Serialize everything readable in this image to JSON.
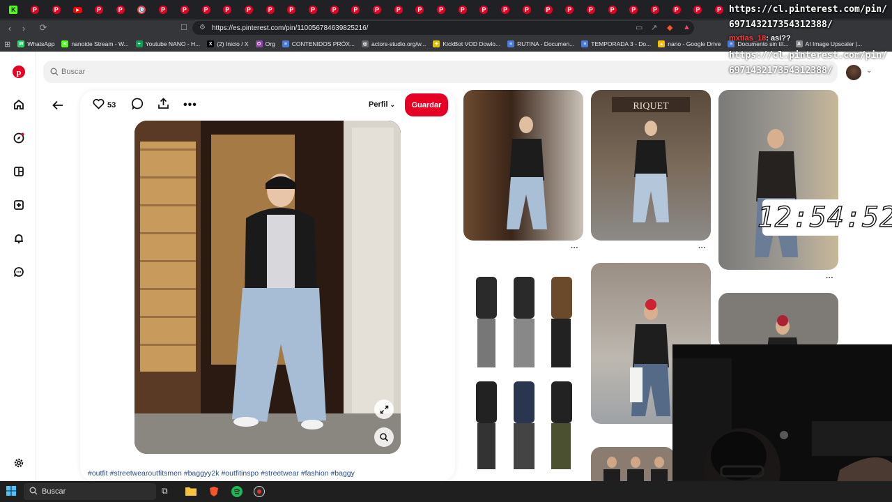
{
  "browser": {
    "tabs": [
      {
        "icon": "K",
        "kind": "k"
      },
      {
        "icon": "P",
        "kind": "p"
      },
      {
        "icon": "P",
        "kind": "p"
      },
      {
        "icon": "▶",
        "kind": "yt"
      },
      {
        "icon": "P",
        "kind": "p"
      },
      {
        "icon": "P",
        "kind": "p"
      },
      {
        "icon": "G",
        "kind": "g"
      },
      {
        "icon": "P",
        "kind": "p"
      },
      {
        "icon": "P",
        "kind": "p"
      },
      {
        "icon": "P",
        "kind": "p"
      },
      {
        "icon": "P",
        "kind": "p"
      },
      {
        "icon": "P",
        "kind": "p"
      },
      {
        "icon": "P",
        "kind": "p"
      },
      {
        "icon": "P",
        "kind": "p"
      },
      {
        "icon": "P",
        "kind": "p"
      },
      {
        "icon": "P",
        "kind": "p"
      },
      {
        "icon": "P",
        "kind": "p"
      },
      {
        "icon": "P",
        "kind": "p"
      },
      {
        "icon": "P",
        "kind": "p"
      },
      {
        "icon": "P",
        "kind": "p"
      },
      {
        "icon": "P",
        "kind": "p"
      },
      {
        "icon": "P",
        "kind": "p"
      },
      {
        "icon": "P",
        "kind": "p"
      },
      {
        "icon": "P",
        "kind": "p"
      },
      {
        "icon": "P",
        "kind": "p"
      },
      {
        "icon": "P",
        "kind": "p"
      },
      {
        "icon": "P",
        "kind": "p"
      },
      {
        "icon": "P",
        "kind": "p"
      },
      {
        "icon": "P",
        "kind": "p"
      },
      {
        "icon": "P",
        "kind": "p"
      },
      {
        "icon": "P",
        "kind": "p"
      },
      {
        "icon": "P",
        "kind": "p"
      },
      {
        "icon": "P",
        "kind": "p"
      },
      {
        "icon": "P",
        "kind": "p"
      }
    ],
    "url": "https://es.pinterest.com/pin/110056784639825216/",
    "bookmarks": [
      {
        "label": "WhatsApp",
        "color": "#25d366",
        "glyph": "W"
      },
      {
        "label": "nanoide Stream - W...",
        "color": "#53fc18",
        "glyph": "K"
      },
      {
        "label": "Youtube NANO - H...",
        "color": "#0f9d58",
        "glyph": "+"
      },
      {
        "label": "(2) Inicio / X",
        "color": "#000000",
        "glyph": "X"
      },
      {
        "label": "Org",
        "color": "#8e44ad",
        "glyph": "O"
      },
      {
        "label": "CONTENIDOS PRÓX...",
        "color": "#4a7bd6",
        "glyph": "≡"
      },
      {
        "label": "actors-studio.org/w...",
        "color": "#666666",
        "glyph": "◎"
      },
      {
        "label": "KickBot VOD Dowlo...",
        "color": "#e0c200",
        "glyph": "✦"
      },
      {
        "label": "RUTINA - Documen...",
        "color": "#4a7bd6",
        "glyph": "≡"
      },
      {
        "label": "TEMPORADA 3 - Do...",
        "color": "#4a7bd6",
        "glyph": "≡"
      },
      {
        "label": "nano - Google Drive",
        "color": "#fbbc04",
        "glyph": "▲"
      },
      {
        "label": "Documento sin tít...",
        "color": "#4a7bd6",
        "glyph": "≡"
      },
      {
        "label": "AI Image Upscaler |...",
        "color": "#888888",
        "glyph": "A"
      }
    ]
  },
  "search": {
    "placeholder": "Buscar"
  },
  "pin": {
    "likes": "53",
    "profile_label": "Perfil",
    "save_label": "Guardar",
    "tags": "#outfit #streetwearoutfitsmen #baggyy2k #outfitinspo #streetwear #fashion #baggy"
  },
  "overlay": {
    "url_text": "https://cl.pinterest.com/pin/697143217354312388/",
    "chat_user": "mxtias_18",
    "chat_msg": ": asi??",
    "url_text2": "https://cl.pinterest.com/pin/697143217354312388/",
    "clock": "12:54:52"
  },
  "taskbar": {
    "search_label": "Buscar"
  }
}
